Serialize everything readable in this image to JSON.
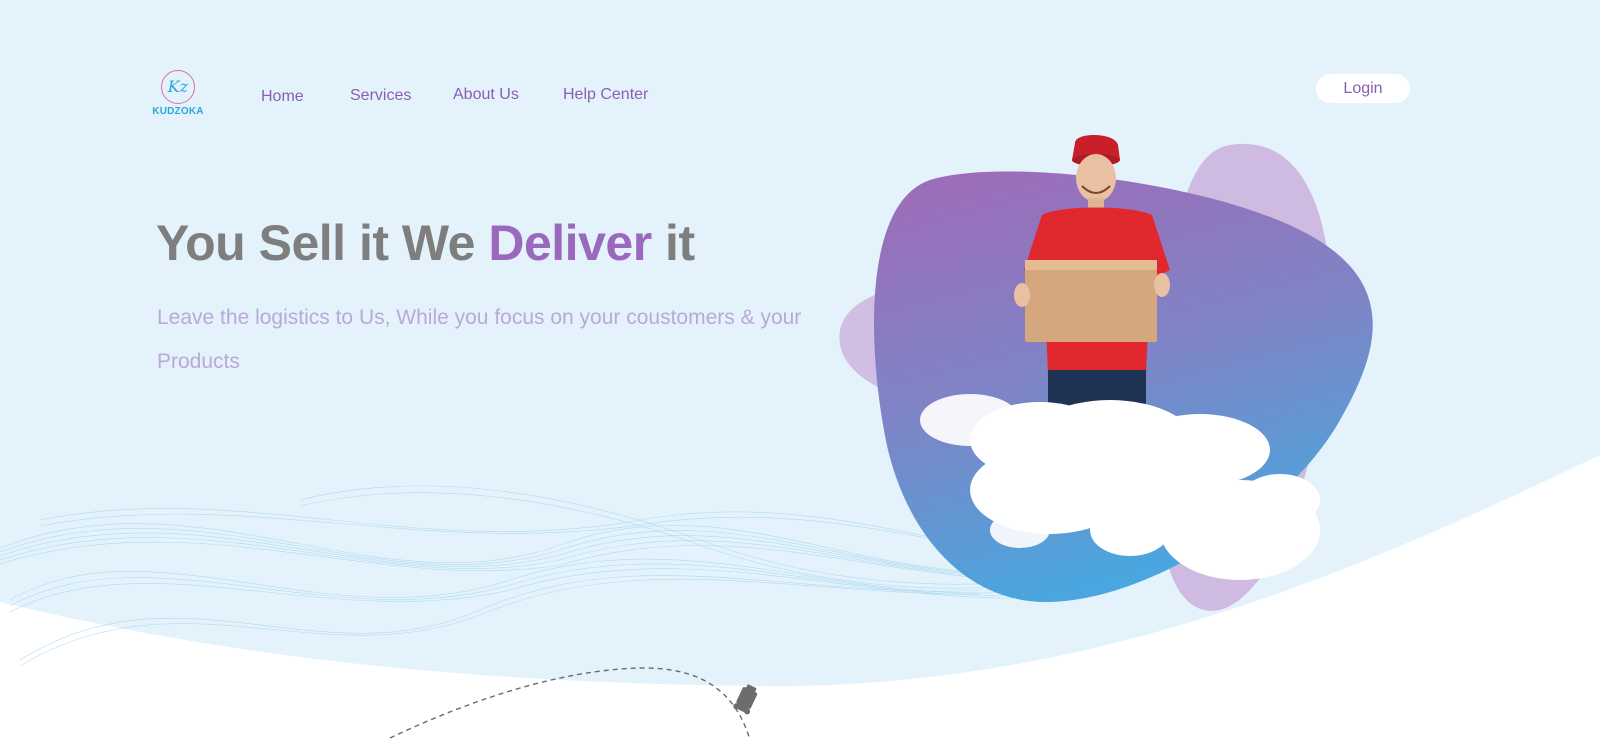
{
  "brand": {
    "logo_initials": "Kz",
    "logo_text": "KUDZOKA"
  },
  "nav": {
    "items": [
      {
        "label": "Home"
      },
      {
        "label": "Services"
      },
      {
        "label": "About Us"
      },
      {
        "label": "Help Center"
      }
    ]
  },
  "header": {
    "login_label": "Login"
  },
  "hero": {
    "title_part1": "You Sell it We ",
    "title_accent": "Deliver",
    "title_part2": " it",
    "subtitle": "Leave the logistics to Us, While you focus on your coustomers & your Products"
  },
  "colors": {
    "background": "#e4f3fb",
    "accent_purple": "#9a68bd",
    "nav_text": "#8a5fb2",
    "title_gray": "#7e7e7e",
    "blob_top": "#a06ab8",
    "blob_bottom": "#4aa6de"
  },
  "icons": {
    "delivery_vehicle": "delivery-truck-icon"
  }
}
